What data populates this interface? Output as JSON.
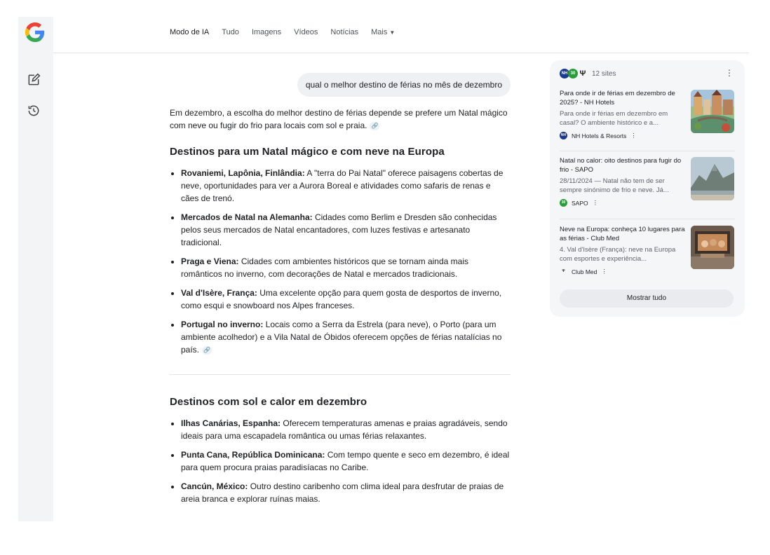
{
  "topnav": {
    "tabs": [
      {
        "label": "Modo de IA"
      },
      {
        "label": "Tudo"
      },
      {
        "label": "Imagens"
      },
      {
        "label": "Vídeos"
      },
      {
        "label": "Notícias"
      },
      {
        "label": "Mais"
      }
    ]
  },
  "query": "qual o melhor destino de férias no mês de dezembro",
  "answer": {
    "intro": "Em dezembro, a escolha do melhor destino de férias depende se prefere um Natal mágico com neve ou fugir do frio para locais com sol e praia.",
    "section1": {
      "heading": "Destinos para um Natal mágico e com neve na Europa",
      "items": [
        {
          "bold": "Rovaniemi, Lapônia, Finlândia:",
          "text": " A \"terra do Pai Natal\" oferece paisagens cobertas de neve, oportunidades para ver a Aurora Boreal e atividades como safaris de renas e cães de trenó."
        },
        {
          "bold": "Mercados de Natal na Alemanha:",
          "text": " Cidades como Berlim e Dresden são conhecidas pelos seus mercados de Natal encantadores, com luzes festivas e artesanato tradicional."
        },
        {
          "bold": "Praga e Viena:",
          "text": " Cidades com ambientes históricos que se tornam ainda mais românticos no inverno, com decorações de Natal e mercados tradicionais."
        },
        {
          "bold": "Val d'Isère, França:",
          "text": " Uma excelente opção para quem gosta de desportos de inverno, como esqui e snowboard nos Alpes franceses."
        },
        {
          "bold": "Portugal no inverno:",
          "text": " Locais como a Serra da Estrela (para neve), o Porto (para um ambiente acolhedor) e a Vila Natal de Óbidos oferecem opções de férias natalícias no país."
        }
      ]
    },
    "section2": {
      "heading": "Destinos com sol e calor em dezembro",
      "items": [
        {
          "bold": "Ilhas Canárias, Espanha:",
          "text": " Oferecem temperaturas amenas e praias agradáveis, sendo ideais para uma escapadela romântica ou umas férias relaxantes."
        },
        {
          "bold": "Punta Cana, República Dominicana:",
          "text": " Com tempo quente e seco em dezembro, é ideal para quem procura praias paradisíacas no Caribe."
        },
        {
          "bold": "Cancún, México:",
          "text": " Outro destino caribenho com clima ideal para desfrutar de praias de areia branca e explorar ruínas maias."
        }
      ]
    }
  },
  "sources": {
    "count_label": "12 sites",
    "favicons": [
      "NH",
      "30"
    ],
    "cards": [
      {
        "title": "Para onde ir de férias em dezembro de 2025? - NH Hotels",
        "snippet": "Para onde ir férias em dezembro em casal? O ambiente histórico e a...",
        "site": "NH Hotels & Resorts",
        "fav": "NH"
      },
      {
        "title": "Natal no calor: oito destinos para fugir do frio - SAPO",
        "snippet": "28/11/2024 — Natal não tem de ser sempre sinónimo de frio e neve. Já...",
        "site": "SAPO",
        "fav": "30"
      },
      {
        "title": "Neve na Europa: conheça 10 lugares para as férias - Club Med",
        "snippet": "4. Val d'Isère (França): neve na Europa com esportes e experiência...",
        "site": "Club Med",
        "fav": "Ψ"
      }
    ],
    "show_all": "Mostrar tudo"
  },
  "colors": {
    "accent_blue": "#4285F4",
    "accent_red": "#EA4335",
    "accent_yellow": "#FBBC05",
    "accent_green": "#34A853"
  }
}
